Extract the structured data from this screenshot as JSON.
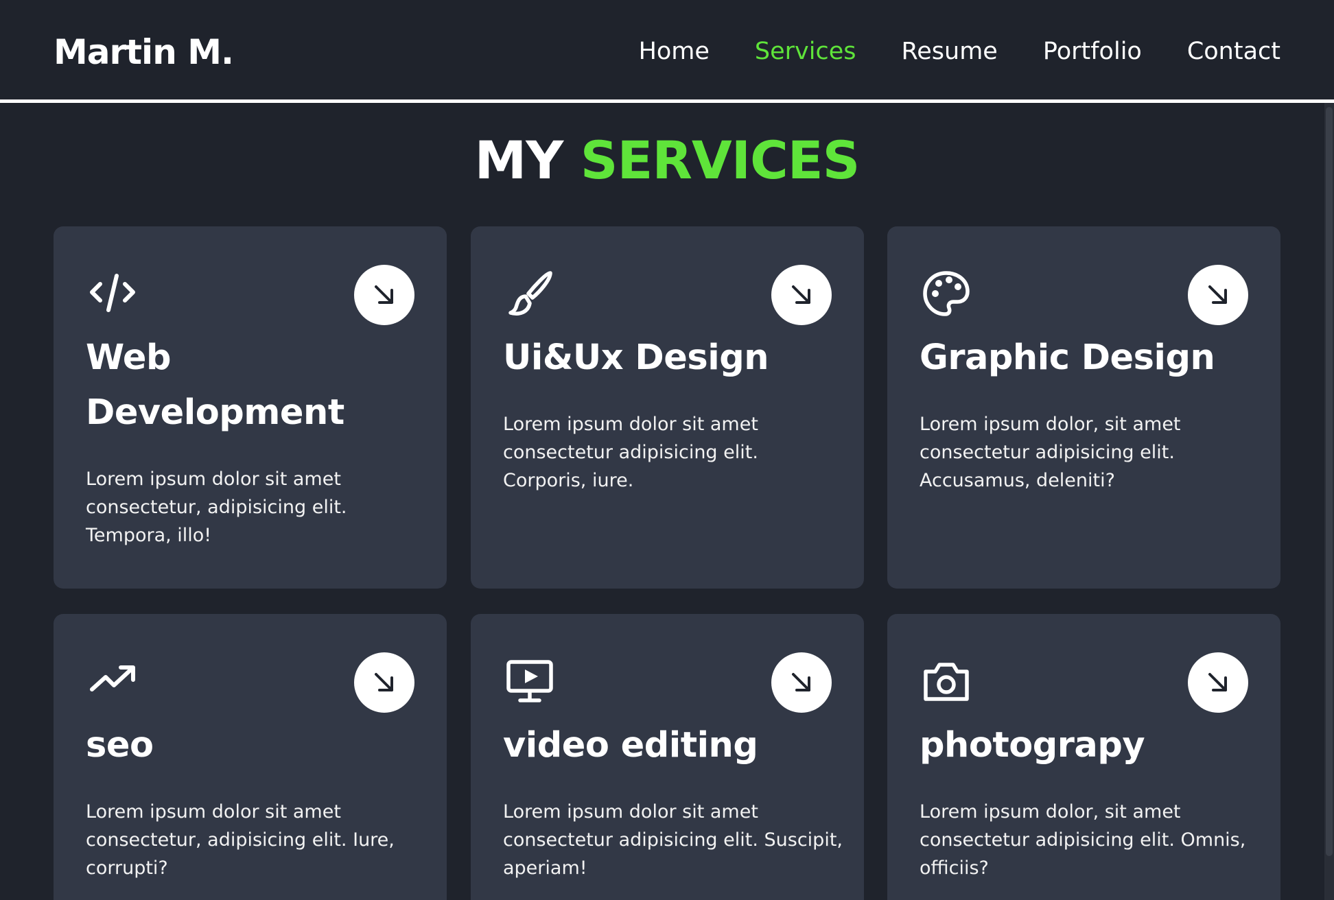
{
  "header": {
    "logo": "Martin M.",
    "nav": [
      {
        "label": "Home",
        "active": false
      },
      {
        "label": "Services",
        "active": true
      },
      {
        "label": "Resume",
        "active": false
      },
      {
        "label": "Portfolio",
        "active": false
      },
      {
        "label": "Contact",
        "active": false
      }
    ]
  },
  "section": {
    "title_prefix": "MY",
    "title_accent": "SERVICES"
  },
  "cards": [
    {
      "icon": "code-icon",
      "title": "Web Development",
      "description": "Lorem ipsum dolor sit amet consectetur, adipisicing elit. Tempora, illo!"
    },
    {
      "icon": "paintbrush-icon",
      "title": "Ui&Ux Design",
      "description": "Lorem ipsum dolor sit amet consectetur adipisicing elit. Corporis, iure."
    },
    {
      "icon": "palette-icon",
      "title": "Graphic Design",
      "description": "Lorem ipsum dolor, sit amet consectetur adipisicing elit. Accusamus, deleniti?"
    },
    {
      "icon": "trending-up-icon",
      "title": "seo",
      "description": "Lorem ipsum dolor sit amet consectetur, adipisicing elit. Iure, corrupti?"
    },
    {
      "icon": "video-screen-icon",
      "title": "video editing",
      "description": "Lorem ipsum dolor sit amet consectetur adipisicing elit. Suscipit, aperiam!"
    },
    {
      "icon": "camera-icon",
      "title": "photograpy",
      "description": "Lorem ipsum dolor, sit amet consectetur adipisicing elit. Omnis, officiis?"
    }
  ],
  "colors": {
    "background": "#1f232c",
    "card": "#323846",
    "accent": "#5fe43a",
    "text": "#ffffff"
  }
}
